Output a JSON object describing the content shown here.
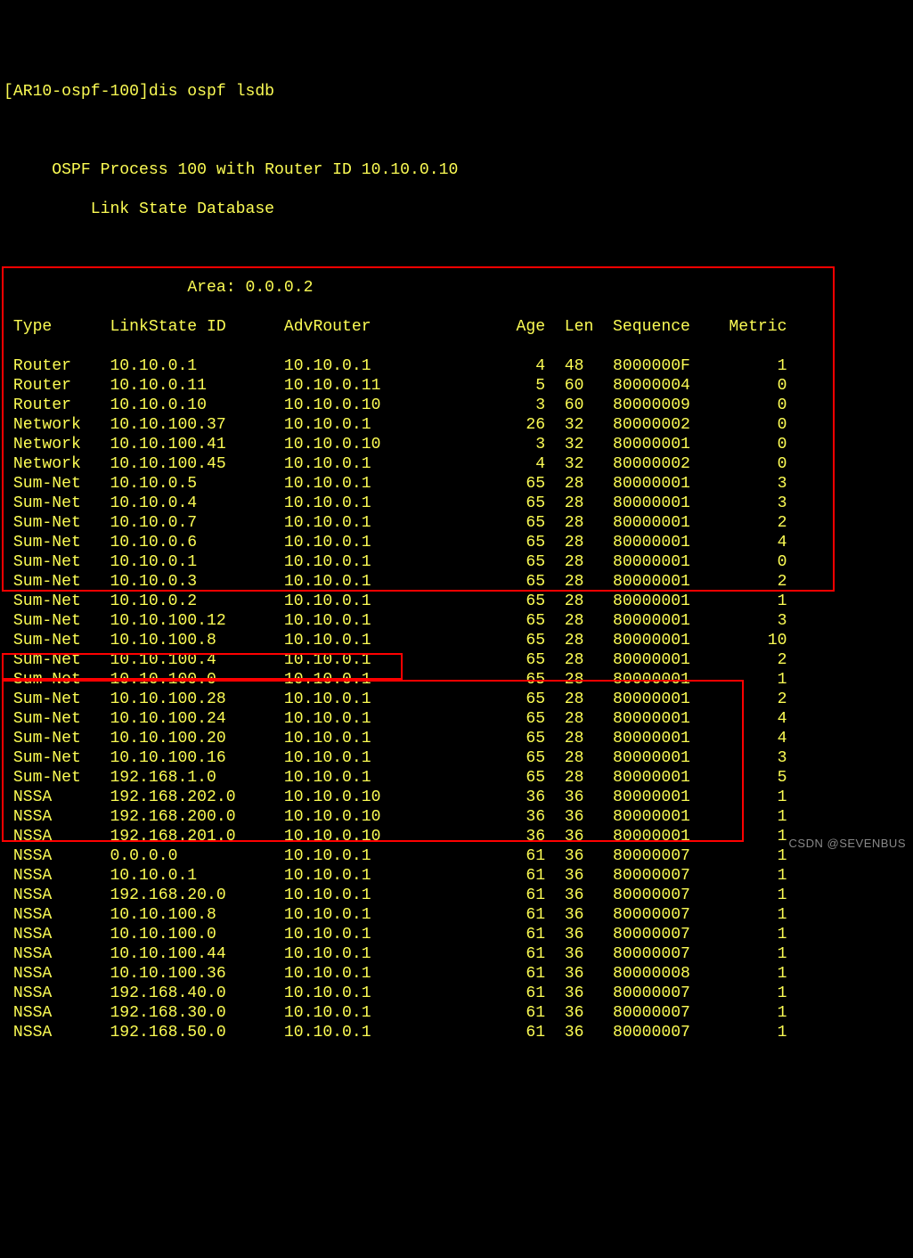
{
  "prompt": "[AR10-ospf-100]",
  "command": "dis ospf lsdb",
  "header1": "OSPF Process 100 with Router ID 10.10.0.10",
  "header2": "Link State Database",
  "area": "Area: 0.0.0.2",
  "cols": {
    "type": "Type",
    "ls": "LinkState ID",
    "adv": "AdvRouter",
    "age": "Age",
    "len": "Len",
    "seq": "Sequence",
    "met": "Metric"
  },
  "rows": [
    {
      "t": "Router",
      "ls": "10.10.0.1",
      "adv": "10.10.0.1",
      "age": "4",
      "len": "48",
      "seq": "8000000F",
      "met": "1"
    },
    {
      "t": "Router",
      "ls": "10.10.0.11",
      "adv": "10.10.0.11",
      "age": "5",
      "len": "60",
      "seq": "80000004",
      "met": "0"
    },
    {
      "t": "Router",
      "ls": "10.10.0.10",
      "adv": "10.10.0.10",
      "age": "3",
      "len": "60",
      "seq": "80000009",
      "met": "0"
    },
    {
      "t": "Network",
      "ls": "10.10.100.37",
      "adv": "10.10.0.1",
      "age": "26",
      "len": "32",
      "seq": "80000002",
      "met": "0"
    },
    {
      "t": "Network",
      "ls": "10.10.100.41",
      "adv": "10.10.0.10",
      "age": "3",
      "len": "32",
      "seq": "80000001",
      "met": "0"
    },
    {
      "t": "Network",
      "ls": "10.10.100.45",
      "adv": "10.10.0.1",
      "age": "4",
      "len": "32",
      "seq": "80000002",
      "met": "0"
    },
    {
      "t": "Sum-Net",
      "ls": "10.10.0.5",
      "adv": "10.10.0.1",
      "age": "65",
      "len": "28",
      "seq": "80000001",
      "met": "3"
    },
    {
      "t": "Sum-Net",
      "ls": "10.10.0.4",
      "adv": "10.10.0.1",
      "age": "65",
      "len": "28",
      "seq": "80000001",
      "met": "3"
    },
    {
      "t": "Sum-Net",
      "ls": "10.10.0.7",
      "adv": "10.10.0.1",
      "age": "65",
      "len": "28",
      "seq": "80000001",
      "met": "2"
    },
    {
      "t": "Sum-Net",
      "ls": "10.10.0.6",
      "adv": "10.10.0.1",
      "age": "65",
      "len": "28",
      "seq": "80000001",
      "met": "4"
    },
    {
      "t": "Sum-Net",
      "ls": "10.10.0.1",
      "adv": "10.10.0.1",
      "age": "65",
      "len": "28",
      "seq": "80000001",
      "met": "0"
    },
    {
      "t": "Sum-Net",
      "ls": "10.10.0.3",
      "adv": "10.10.0.1",
      "age": "65",
      "len": "28",
      "seq": "80000001",
      "met": "2"
    },
    {
      "t": "Sum-Net",
      "ls": "10.10.0.2",
      "adv": "10.10.0.1",
      "age": "65",
      "len": "28",
      "seq": "80000001",
      "met": "1"
    },
    {
      "t": "Sum-Net",
      "ls": "10.10.100.12",
      "adv": "10.10.0.1",
      "age": "65",
      "len": "28",
      "seq": "80000001",
      "met": "3"
    },
    {
      "t": "Sum-Net",
      "ls": "10.10.100.8",
      "adv": "10.10.0.1",
      "age": "65",
      "len": "28",
      "seq": "80000001",
      "met": "10"
    },
    {
      "t": "Sum-Net",
      "ls": "10.10.100.4",
      "adv": "10.10.0.1",
      "age": "65",
      "len": "28",
      "seq": "80000001",
      "met": "2"
    },
    {
      "t": "Sum-Net",
      "ls": "10.10.100.0",
      "adv": "10.10.0.1",
      "age": "65",
      "len": "28",
      "seq": "80000001",
      "met": "1"
    },
    {
      "t": "Sum-Net",
      "ls": "10.10.100.28",
      "adv": "10.10.0.1",
      "age": "65",
      "len": "28",
      "seq": "80000001",
      "met": "2"
    },
    {
      "t": "Sum-Net",
      "ls": "10.10.100.24",
      "adv": "10.10.0.1",
      "age": "65",
      "len": "28",
      "seq": "80000001",
      "met": "4"
    },
    {
      "t": "Sum-Net",
      "ls": "10.10.100.20",
      "adv": "10.10.0.1",
      "age": "65",
      "len": "28",
      "seq": "80000001",
      "met": "4"
    },
    {
      "t": "Sum-Net",
      "ls": "10.10.100.16",
      "adv": "10.10.0.1",
      "age": "65",
      "len": "28",
      "seq": "80000001",
      "met": "3"
    },
    {
      "t": "Sum-Net",
      "ls": "192.168.1.0",
      "adv": "10.10.0.1",
      "age": "65",
      "len": "28",
      "seq": "80000001",
      "met": "5"
    },
    {
      "t": "NSSA",
      "ls": "192.168.202.0",
      "adv": "10.10.0.10",
      "age": "36",
      "len": "36",
      "seq": "80000001",
      "met": "1"
    },
    {
      "t": "NSSA",
      "ls": "192.168.200.0",
      "adv": "10.10.0.10",
      "age": "36",
      "len": "36",
      "seq": "80000001",
      "met": "1"
    },
    {
      "t": "NSSA",
      "ls": "192.168.201.0",
      "adv": "10.10.0.10",
      "age": "36",
      "len": "36",
      "seq": "80000001",
      "met": "1"
    },
    {
      "t": "NSSA",
      "ls": "0.0.0.0",
      "adv": "10.10.0.1",
      "age": "61",
      "len": "36",
      "seq": "80000007",
      "met": "1"
    },
    {
      "t": "NSSA",
      "ls": "10.10.0.1",
      "adv": "10.10.0.1",
      "age": "61",
      "len": "36",
      "seq": "80000007",
      "met": "1"
    },
    {
      "t": "NSSA",
      "ls": "192.168.20.0",
      "adv": "10.10.0.1",
      "age": "61",
      "len": "36",
      "seq": "80000007",
      "met": "1"
    },
    {
      "t": "NSSA",
      "ls": "10.10.100.8",
      "adv": "10.10.0.1",
      "age": "61",
      "len": "36",
      "seq": "80000007",
      "met": "1"
    },
    {
      "t": "NSSA",
      "ls": "10.10.100.0",
      "adv": "10.10.0.1",
      "age": "61",
      "len": "36",
      "seq": "80000007",
      "met": "1"
    },
    {
      "t": "NSSA",
      "ls": "10.10.100.44",
      "adv": "10.10.0.1",
      "age": "61",
      "len": "36",
      "seq": "80000007",
      "met": "1"
    },
    {
      "t": "NSSA",
      "ls": "10.10.100.36",
      "adv": "10.10.0.1",
      "age": "61",
      "len": "36",
      "seq": "80000008",
      "met": "1"
    },
    {
      "t": "NSSA",
      "ls": "192.168.40.0",
      "adv": "10.10.0.1",
      "age": "61",
      "len": "36",
      "seq": "80000007",
      "met": "1"
    },
    {
      "t": "NSSA",
      "ls": "192.168.30.0",
      "adv": "10.10.0.1",
      "age": "61",
      "len": "36",
      "seq": "80000007",
      "met": "1"
    },
    {
      "t": "NSSA",
      "ls": "192.168.50.0",
      "adv": "10.10.0.1",
      "age": "61",
      "len": "36",
      "seq": "80000007",
      "met": "1"
    }
  ],
  "watermark": "CSDN @SEVENBUS"
}
